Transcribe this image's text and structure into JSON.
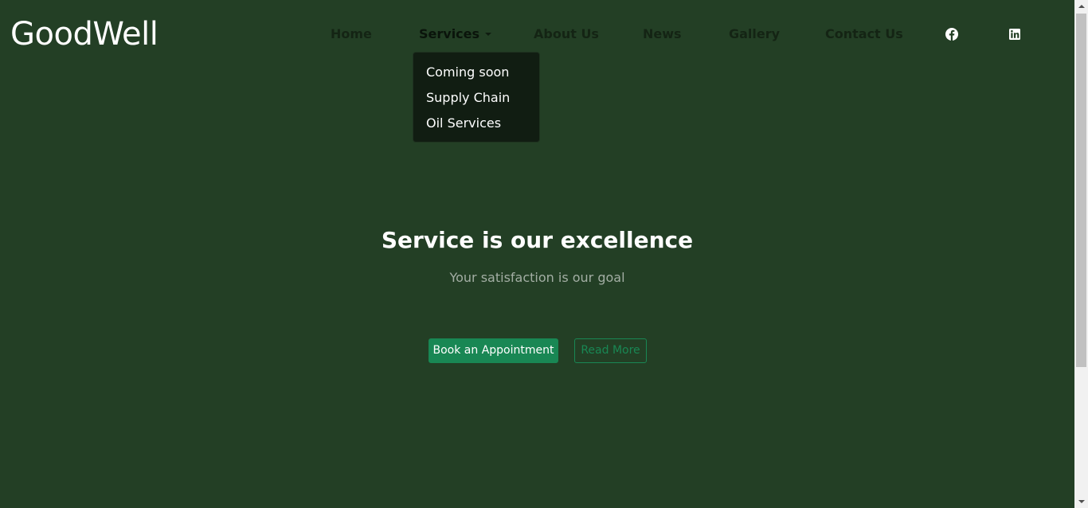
{
  "brand": {
    "name": "GoodWell"
  },
  "nav": {
    "items": [
      {
        "label": "Home"
      },
      {
        "label": "Services"
      },
      {
        "label": "About Us"
      },
      {
        "label": "News"
      },
      {
        "label": "Gallery"
      },
      {
        "label": "Contact Us"
      }
    ],
    "social": [
      {
        "icon": "facebook-icon"
      },
      {
        "icon": "linkedin-icon"
      }
    ]
  },
  "services_dropdown": {
    "items": [
      {
        "label": "Coming soon"
      },
      {
        "label": "Supply Chain"
      },
      {
        "label": "Oil Services"
      }
    ]
  },
  "hero": {
    "title": "Service is our excellence",
    "subtitle": "Your satisfaction is our goal",
    "primary_button": "Book an Appointment",
    "secondary_button": "Read More"
  },
  "colors": {
    "background": "#233f25",
    "dropdown_bg": "#111d12",
    "accent": "#198754",
    "nav_text": "#142414",
    "subtitle_text": "#a3aea4"
  }
}
